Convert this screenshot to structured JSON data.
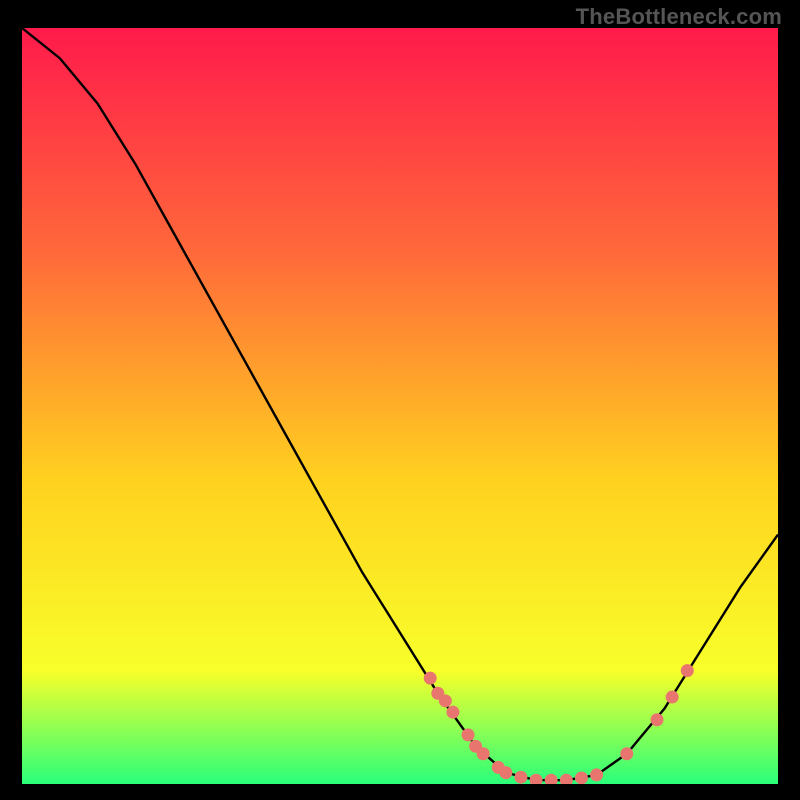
{
  "watermark": "TheBottleneck.com",
  "chart_data": {
    "type": "line",
    "title": "",
    "xlabel": "",
    "ylabel": "",
    "xlim": [
      0,
      100
    ],
    "ylim": [
      0,
      100
    ],
    "gradient_colors": {
      "top": "#ff1a4b",
      "mid_upper": "#ff6a3a",
      "mid": "#ffd21f",
      "mid_lower": "#f8ff2a",
      "bottom": "#2aff7a"
    },
    "curve": [
      {
        "x": 0,
        "y": 100
      },
      {
        "x": 5,
        "y": 96
      },
      {
        "x": 10,
        "y": 90
      },
      {
        "x": 15,
        "y": 82
      },
      {
        "x": 20,
        "y": 73
      },
      {
        "x": 25,
        "y": 64
      },
      {
        "x": 30,
        "y": 55
      },
      {
        "x": 35,
        "y": 46
      },
      {
        "x": 40,
        "y": 37
      },
      {
        "x": 45,
        "y": 28
      },
      {
        "x": 50,
        "y": 20
      },
      {
        "x": 55,
        "y": 12
      },
      {
        "x": 60,
        "y": 5
      },
      {
        "x": 64,
        "y": 1.5
      },
      {
        "x": 68,
        "y": 0.5
      },
      {
        "x": 72,
        "y": 0.5
      },
      {
        "x": 76,
        "y": 1.2
      },
      {
        "x": 80,
        "y": 4
      },
      {
        "x": 85,
        "y": 10
      },
      {
        "x": 90,
        "y": 18
      },
      {
        "x": 95,
        "y": 26
      },
      {
        "x": 100,
        "y": 33
      }
    ],
    "markers": [
      {
        "x": 54,
        "y": 14
      },
      {
        "x": 55,
        "y": 12
      },
      {
        "x": 56,
        "y": 11
      },
      {
        "x": 57,
        "y": 9.5
      },
      {
        "x": 59,
        "y": 6.5
      },
      {
        "x": 60,
        "y": 5
      },
      {
        "x": 61,
        "y": 4
      },
      {
        "x": 63,
        "y": 2.2
      },
      {
        "x": 64,
        "y": 1.5
      },
      {
        "x": 66,
        "y": 0.9
      },
      {
        "x": 68,
        "y": 0.5
      },
      {
        "x": 70,
        "y": 0.5
      },
      {
        "x": 72,
        "y": 0.5
      },
      {
        "x": 74,
        "y": 0.8
      },
      {
        "x": 76,
        "y": 1.2
      },
      {
        "x": 80,
        "y": 4
      },
      {
        "x": 84,
        "y": 8.5
      },
      {
        "x": 86,
        "y": 11.5
      },
      {
        "x": 88,
        "y": 15
      }
    ],
    "marker_color": "#e9766e",
    "curve_color": "#000000"
  }
}
